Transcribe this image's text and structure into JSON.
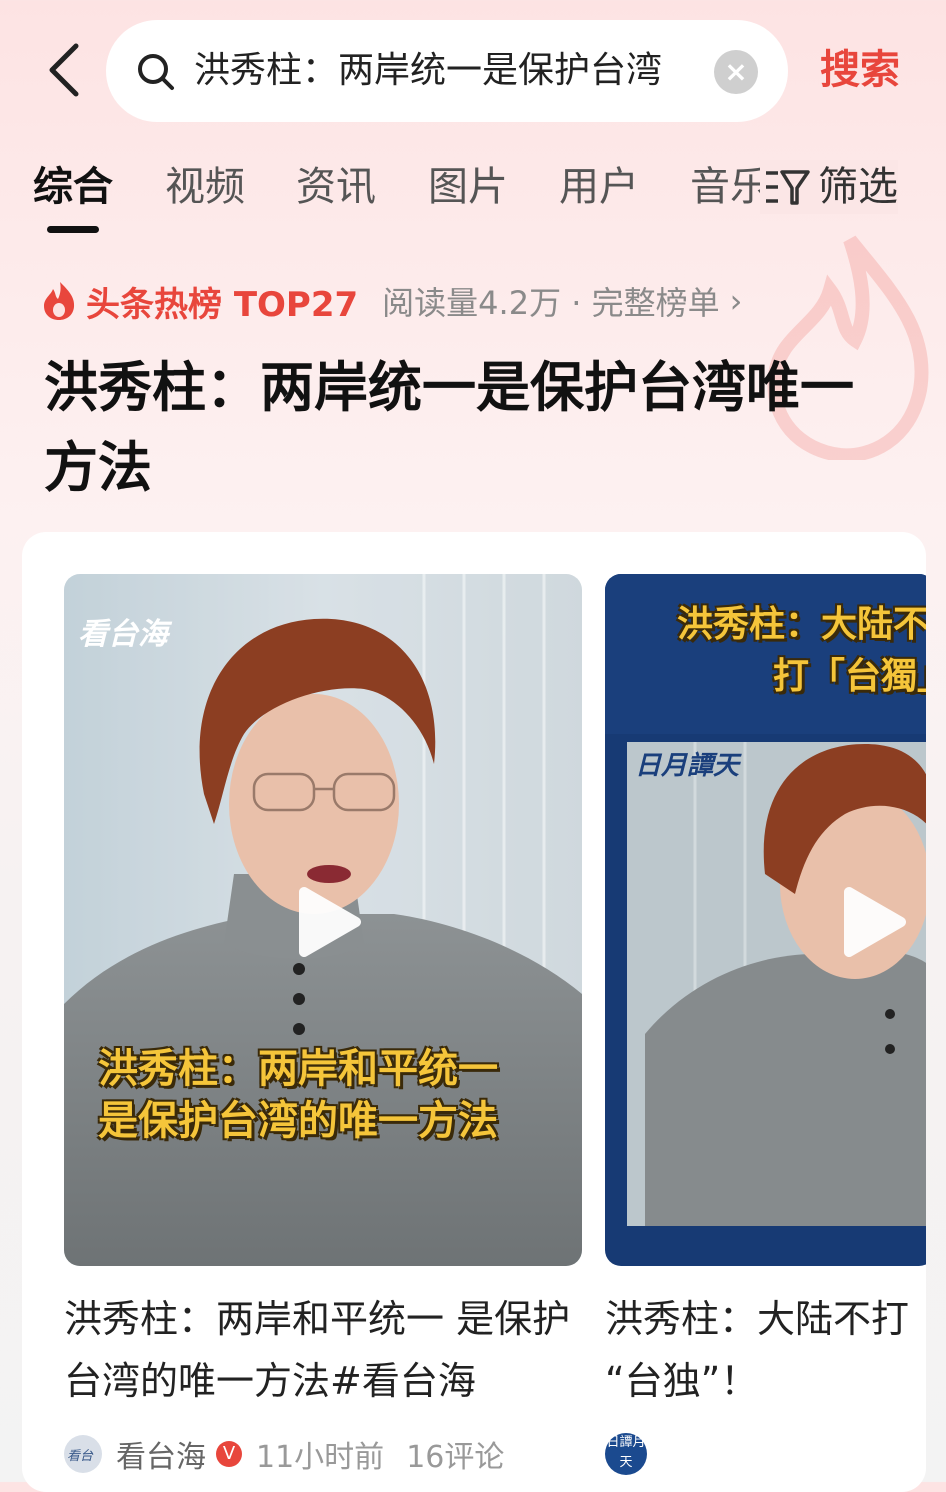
{
  "search": {
    "query": "洪秀柱：两岸统一是保护台湾",
    "button_label": "搜索"
  },
  "tabs": [
    {
      "label": "综合"
    },
    {
      "label": "视频"
    },
    {
      "label": "资讯"
    },
    {
      "label": "图片"
    },
    {
      "label": "用户"
    },
    {
      "label": "音乐"
    }
  ],
  "filter_label": "筛选",
  "hot_rank": {
    "title": "头条热榜 TOP27",
    "meta": "阅读量4.2万 · 完整榜单"
  },
  "headline": "洪秀柱：两岸统一是保护台湾唯一方法",
  "videos": [
    {
      "caption": "洪秀柱：两岸和平统一 是保护台湾的唯一方法#看台海",
      "overlay_line1": "洪秀柱：两岸和平统一",
      "overlay_line2": "是保护台湾的唯一方法",
      "logo": "看台海",
      "source": "看台海",
      "time": "11小时前",
      "comments": "16评论"
    },
    {
      "caption_line1": "洪秀柱：大陆不打",
      "caption_line2": "“台独”！",
      "overlay_line1": "洪秀柱：大陆不",
      "overlay_line2": "打「台獨」",
      "logo": "日月譚天",
      "avatar_text": "日譚月天"
    }
  ],
  "colors": {
    "accent": "#e8463c",
    "overlay_text": "#f5c53a",
    "thumb2_frame": "#173a74"
  }
}
